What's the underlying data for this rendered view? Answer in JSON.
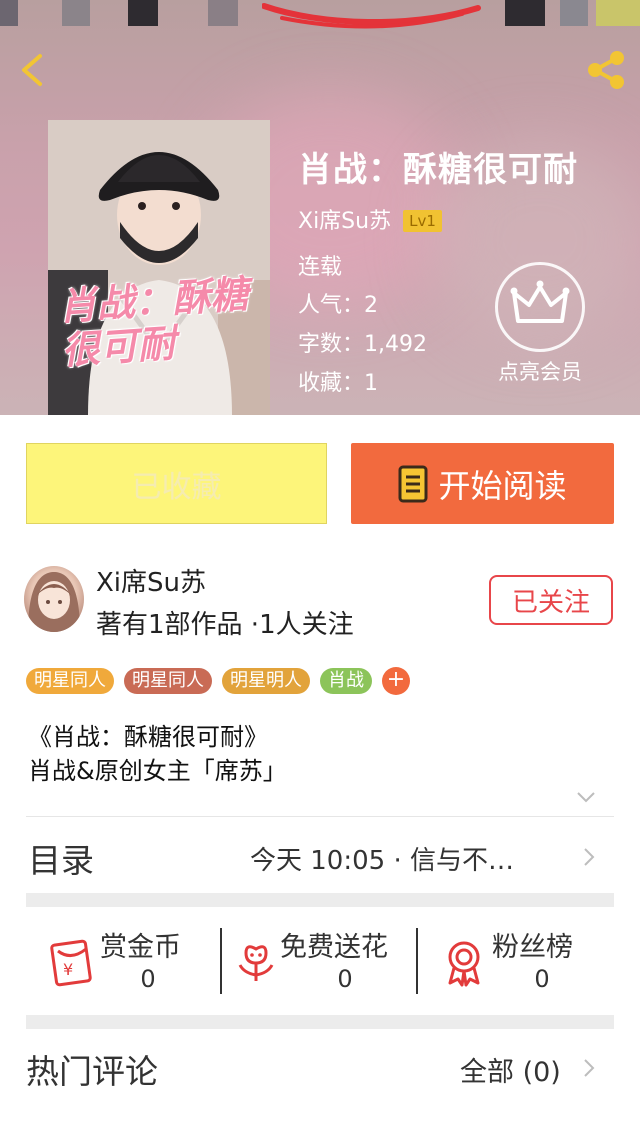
{
  "header": {
    "back_icon": "chevron-left-icon",
    "share_icon": "share-icon"
  },
  "book": {
    "title": "肖战：酥糖很可耐",
    "cover_title": "肖战：酥糖很可耐",
    "author": "Xi席Su苏",
    "level": "Lv1",
    "status": "连载",
    "popularity": "人气：2",
    "word_count": "字数：1,492",
    "favorites": "收藏：1"
  },
  "vip": {
    "icon": "crown-icon",
    "label": "点亮会员"
  },
  "actions": {
    "collected_label": "已收藏",
    "read_label": "开始阅读"
  },
  "author_card": {
    "name": "Xi席Su苏",
    "stats": "著有1部作品 ·1人关注",
    "follow_label": "已关注"
  },
  "tags": [
    {
      "label": "明星同人",
      "color": "#f0a93b"
    },
    {
      "label": "明星同人",
      "color": "#c96b55"
    },
    {
      "label": "明星明人",
      "color": "#e2a33b"
    },
    {
      "label": "肖战",
      "color": "#8cc45a"
    }
  ],
  "tag_add": "+",
  "description": {
    "line1": "《肖战：酥糖很可耐》",
    "line2": "肖战&原创女主「席苏」"
  },
  "toc": {
    "label": "目录",
    "latest": "今天 10:05 · 信与不…"
  },
  "rewards": [
    {
      "label": "赏金币",
      "count": "0",
      "icon": "red-envelope-icon"
    },
    {
      "label": "免费送花",
      "count": "0",
      "icon": "flower-icon"
    },
    {
      "label": "粉丝榜",
      "count": "0",
      "icon": "medal-icon"
    }
  ],
  "comments": {
    "label": "热门评论",
    "all": "全部 (0)"
  },
  "colors": {
    "accent": "#f26a3e",
    "follow": "#e8464a",
    "collected_bg": "#fdf57a"
  }
}
